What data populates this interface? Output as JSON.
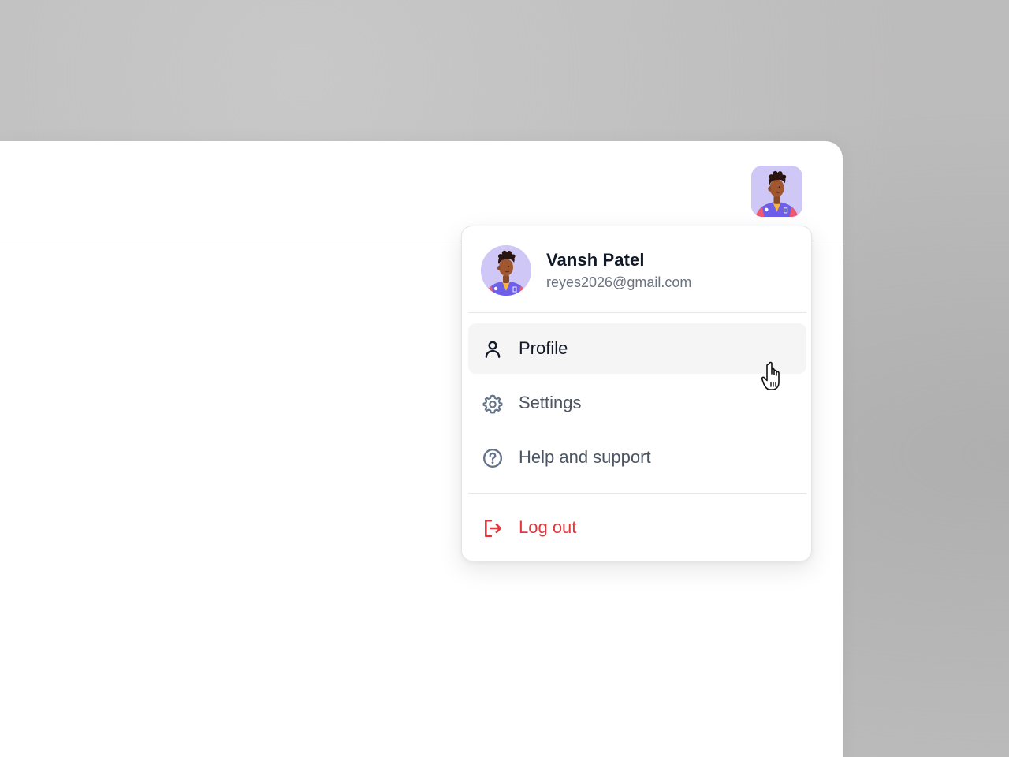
{
  "user": {
    "name": "Vansh Patel",
    "email": "reyes2026@gmail.com",
    "avatar_icon": "user-avatar-illustration"
  },
  "menu": {
    "items": [
      {
        "label": "Profile",
        "icon": "user-icon",
        "state": "hovered"
      },
      {
        "label": "Settings",
        "icon": "gear-icon"
      },
      {
        "label": "Help and support",
        "icon": "help-circle-icon"
      }
    ],
    "logout": {
      "label": "Log out",
      "icon": "logout-icon"
    }
  },
  "colors": {
    "danger": "#e0383e",
    "muted_text": "#4b5563",
    "icon_muted": "#64748b",
    "hover_bg": "#f5f5f5",
    "avatar_bg": "#cfc8f7"
  }
}
